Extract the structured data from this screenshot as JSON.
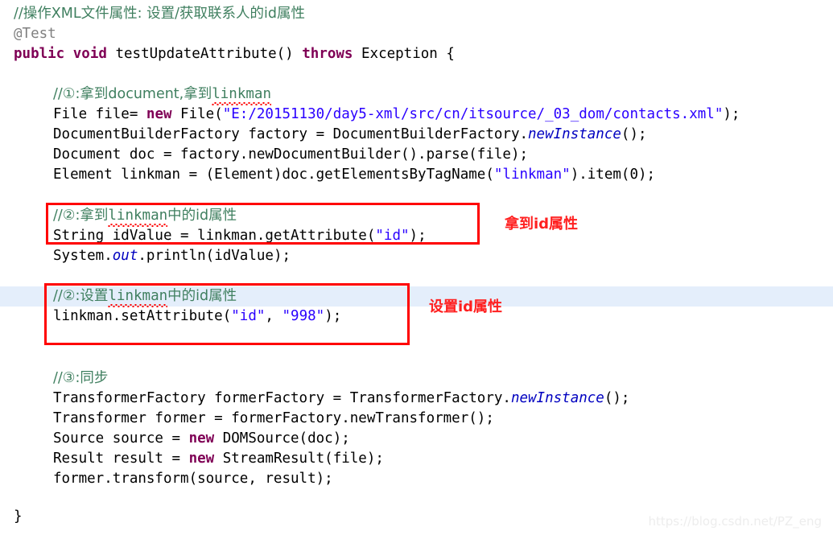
{
  "editor": {
    "language": "java",
    "background_color": "#FFFFFF",
    "font_size_px": 17.5,
    "line_height_px": 25,
    "syntax_colors": {
      "keyword": "#7F0055",
      "comment": "#3F7F5F",
      "string": "#2A00FF",
      "annotation": "#808080",
      "static_field": "#0000C0",
      "plain": "#000000"
    },
    "current_line_highlight_color": "#E4EEFB",
    "annotation_color": "#FF0000"
  },
  "code": {
    "line_01_comment": "//操作XML文件属性: 设置/获取联系人的id属性",
    "line_02_annotation": "@Test",
    "line_03": {
      "kw_public": "public",
      "kw_void": "void",
      "method": " testUpdateAttribute() ",
      "kw_throws": "throws",
      "tail": " Exception {"
    },
    "line_05_comment": "//①:拿到document,拿到",
    "line_05_comment_squiggle": "linkman",
    "line_06": {
      "pre": "File file= ",
      "kw_new": "new",
      "mid": " File(",
      "str": "\"E:/20151130/day5-xml/src/cn/itsource/_03_dom/contacts.xml\"",
      "post": ");"
    },
    "line_07": {
      "pre": "DocumentBuilderFactory factory = DocumentBuilderFactory.",
      "static": "newInstance",
      "post": "();"
    },
    "line_08": "Document doc = factory.newDocumentBuilder().parse(file);",
    "line_09": {
      "pre": "Element linkman = (Element)doc.getElementsByTagName(",
      "str": "\"linkman\"",
      "post": ").item(0);"
    },
    "line_11_comment_a": "//②:拿到",
    "line_11_comment_squiggle": "linkman",
    "line_11_comment_b": "中的id属性",
    "line_12": {
      "pre": "String idValue = linkman.getAttribute(",
      "str": "\"id\"",
      "post": ");"
    },
    "line_13": {
      "pre": "System.",
      "static": "out",
      "post": ".println(idValue);"
    },
    "line_15_comment_a": "//②:设置",
    "line_15_comment_squiggle": "linkman",
    "line_15_comment_b": "中的id属性",
    "line_16": {
      "pre": "linkman.setAttribute(",
      "str1": "\"id\"",
      "mid": ", ",
      "str2": "\"998\"",
      "post": ");"
    },
    "line_18_comment": "//③:同步",
    "line_19": {
      "pre": "TransformerFactory formerFactory = TransformerFactory.",
      "static": "newInstance",
      "post": "();"
    },
    "line_20": "Transformer former = formerFactory.newTransformer();",
    "line_21": {
      "pre": "Source source = ",
      "kw_new": "new",
      "post": " DOMSource(doc);"
    },
    "line_22": {
      "pre": "Result result = ",
      "kw_new": "new",
      "post": " StreamResult(file);"
    },
    "line_23": "former.transform(source, result);",
    "line_25_close_brace": "}"
  },
  "annotations": {
    "label_get_id": "拿到id属性",
    "label_set_id": "设置id属性"
  },
  "watermark": {
    "text": "https://blog.csdn.net/PZ_eng"
  }
}
